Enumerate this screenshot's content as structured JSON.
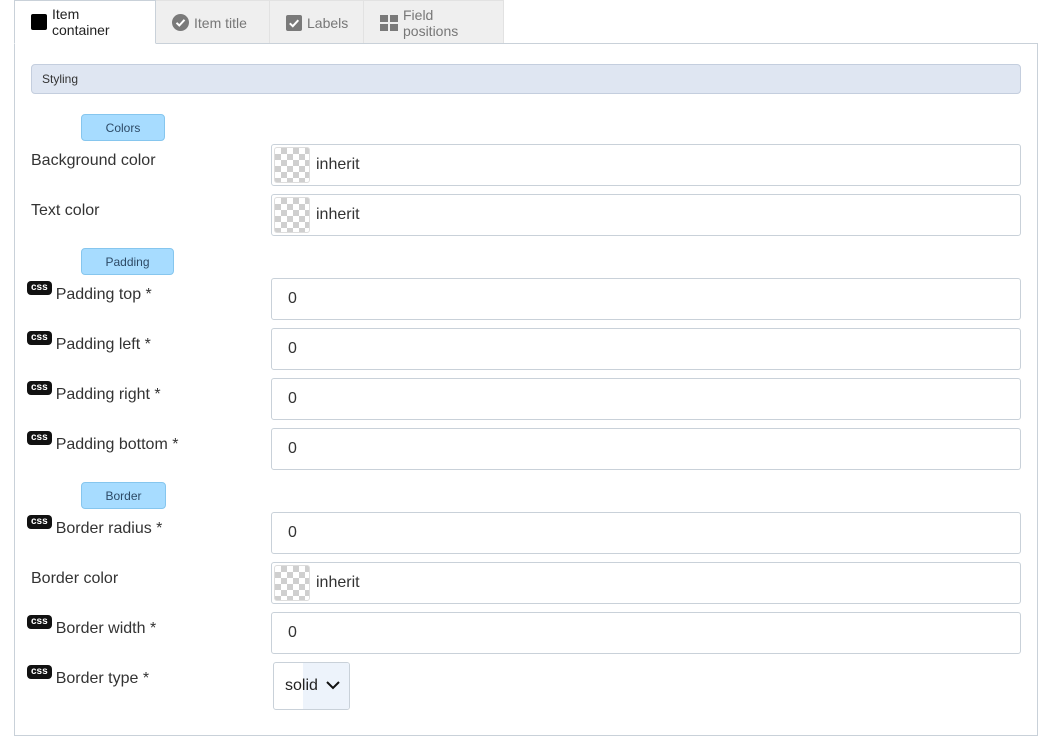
{
  "tabs": [
    {
      "label": "Item container",
      "icon": "black-square-icon",
      "active": true
    },
    {
      "label": "Item title",
      "icon": "check-circle-icon",
      "active": false
    },
    {
      "label": "Labels",
      "icon": "check-square-icon",
      "active": false
    },
    {
      "label": "Field positions",
      "icon": "grid-icon",
      "active": false
    }
  ],
  "styling_header": "Styling",
  "css_badge": "css",
  "sections": {
    "colors": "Colors",
    "padding": "Padding",
    "border": "Border"
  },
  "fields": {
    "background_color": {
      "label": "Background color",
      "value": "inherit"
    },
    "text_color": {
      "label": "Text color",
      "value": "inherit"
    },
    "padding_top": {
      "label": "Padding top *",
      "value": "0"
    },
    "padding_left": {
      "label": "Padding left *",
      "value": "0"
    },
    "padding_right": {
      "label": "Padding right *",
      "value": "0"
    },
    "padding_bottom": {
      "label": "Padding bottom *",
      "value": "0"
    },
    "border_radius": {
      "label": "Border radius *",
      "value": "0"
    },
    "border_color": {
      "label": "Border color",
      "value": "inherit"
    },
    "border_width": {
      "label": "Border width *",
      "value": "0"
    },
    "border_type": {
      "label": "Border type *",
      "value": "solid"
    }
  },
  "colors": {
    "section_button_bg": "#a7dcff",
    "styling_bar_bg": "#dfe6f2"
  }
}
